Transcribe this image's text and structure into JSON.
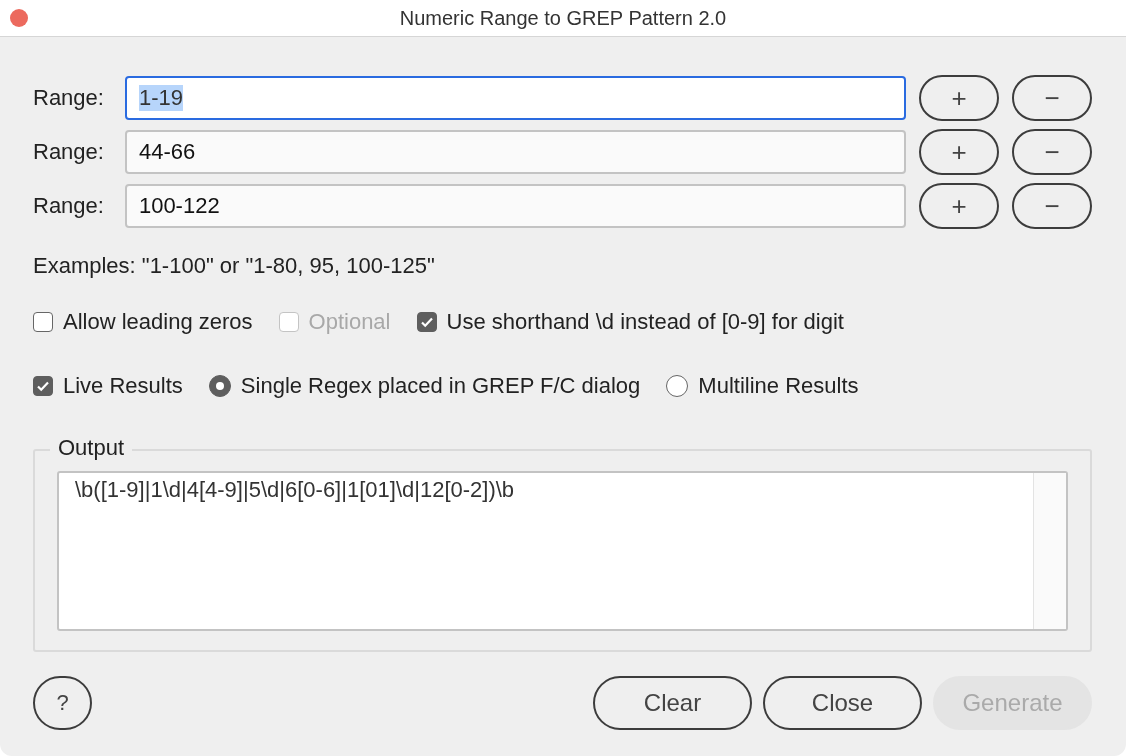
{
  "window": {
    "title": "Numeric Range to GREP Pattern 2.0"
  },
  "ranges": [
    {
      "label": "Range:",
      "value": "1-19",
      "focused": true,
      "add_button": "+",
      "remove_button": "−"
    },
    {
      "label": "Range:",
      "value": "44-66",
      "focused": false,
      "add_button": "+",
      "remove_button": "−"
    },
    {
      "label": "Range:",
      "value": "100-122",
      "focused": false,
      "add_button": "+",
      "remove_button": "−"
    }
  ],
  "examples": "Examples: \"1-100\" or \"1-80, 95, 100-125\"",
  "options": [
    {
      "kind": "checkbox",
      "label": "Allow leading zeros",
      "checked": false,
      "disabled": false
    },
    {
      "kind": "checkbox",
      "label": "Optional",
      "checked": false,
      "disabled": true
    },
    {
      "kind": "checkbox",
      "label": "Use shorthand \\d instead of [0-9] for digit",
      "checked": true,
      "disabled": false
    }
  ],
  "result_options": [
    {
      "kind": "checkbox",
      "label": "Live Results",
      "checked": true
    },
    {
      "kind": "radio",
      "label": "Single Regex placed in GREP F/C dialog",
      "selected": true
    },
    {
      "kind": "radio",
      "label": "Multiline Results",
      "selected": false
    }
  ],
  "output": {
    "label": "Output",
    "value": "\\b([1-9]|1\\d|4[4-9]|5\\d|6[0-6]|1[01]\\d|12[0-2])\\b"
  },
  "buttons": [
    {
      "label": "?",
      "disabled": false
    },
    {
      "label": "Clear",
      "disabled": false
    },
    {
      "label": "Close",
      "disabled": false
    },
    {
      "label": "Generate",
      "disabled": true
    }
  ]
}
